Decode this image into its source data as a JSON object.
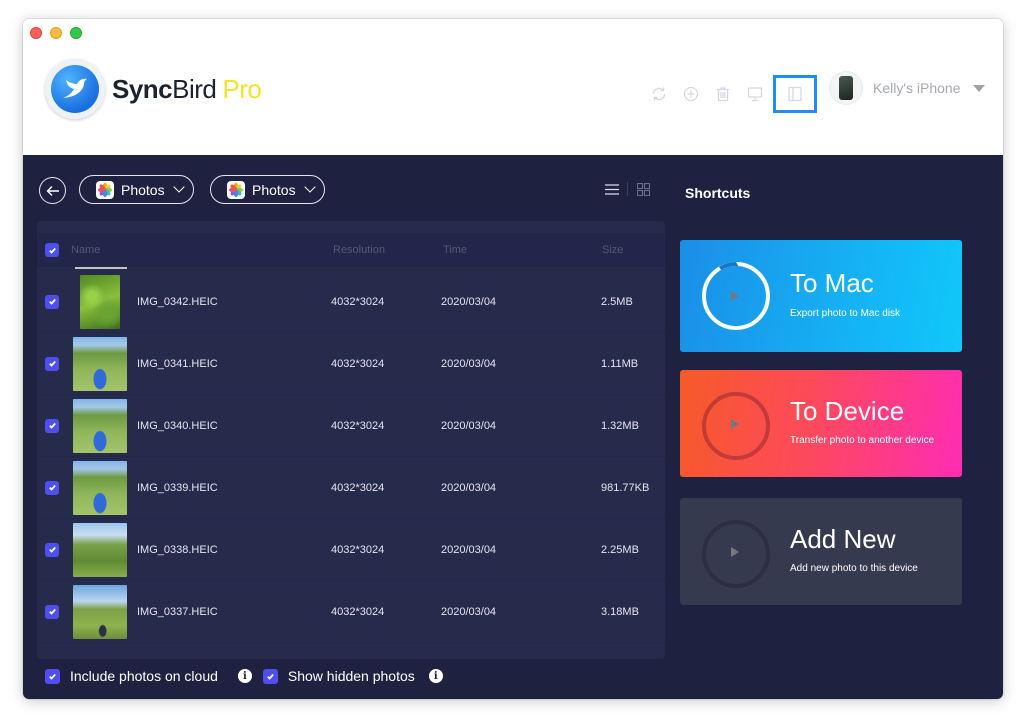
{
  "app": {
    "name_sync": "Sync",
    "name_bird": "Bird",
    "name_pro": "Pro"
  },
  "toolbar": {
    "icons": [
      "refresh-icon",
      "add-icon",
      "trash-icon",
      "monitor-icon",
      "layout-icon"
    ],
    "active_icon": "layout-icon",
    "active_color": "#1e8ef0"
  },
  "device": {
    "name": "Kelly's iPhone"
  },
  "nav": {
    "source_label": "Photos",
    "album_label": "Photos"
  },
  "table": {
    "columns": {
      "name": "Name",
      "resolution": "Resolution",
      "time": "Time",
      "size": "Size"
    },
    "rows": [
      {
        "name": "IMG_0342.HEIC",
        "resolution": "4032*3024",
        "time": "2020/03/04",
        "size": "2.5MB",
        "checked": true,
        "thumb": "flowers"
      },
      {
        "name": "IMG_0341.HEIC",
        "resolution": "4032*3024",
        "time": "2020/03/04",
        "size": "1.11MB",
        "checked": true,
        "thumb": "hero"
      },
      {
        "name": "IMG_0340.HEIC",
        "resolution": "4032*3024",
        "time": "2020/03/04",
        "size": "1.32MB",
        "checked": true,
        "thumb": "hero"
      },
      {
        "name": "IMG_0339.HEIC",
        "resolution": "4032*3024",
        "time": "2020/03/04",
        "size": "981.77KB",
        "checked": true,
        "thumb": "hero"
      },
      {
        "name": "IMG_0338.HEIC",
        "resolution": "4032*3024",
        "time": "2020/03/04",
        "size": "2.25MB",
        "checked": true,
        "thumb": "field"
      },
      {
        "name": "IMG_0337.HEIC",
        "resolution": "4032*3024",
        "time": "2020/03/04",
        "size": "3.18MB",
        "checked": true,
        "thumb": "path"
      }
    ]
  },
  "footer": {
    "include_cloud_label": "Include photos on cloud",
    "include_cloud_checked": true,
    "show_hidden_label": "Show hidden photos",
    "show_hidden_checked": true,
    "info_glyph": "i"
  },
  "shortcuts": {
    "title": "Shortcuts",
    "cards": [
      {
        "title": "To Mac",
        "subtitle": "Export photo to Mac disk"
      },
      {
        "title": "To Device",
        "subtitle": "Transfer photo to another device"
      },
      {
        "title": "Add New",
        "subtitle": "Add new photo to this device"
      }
    ]
  }
}
